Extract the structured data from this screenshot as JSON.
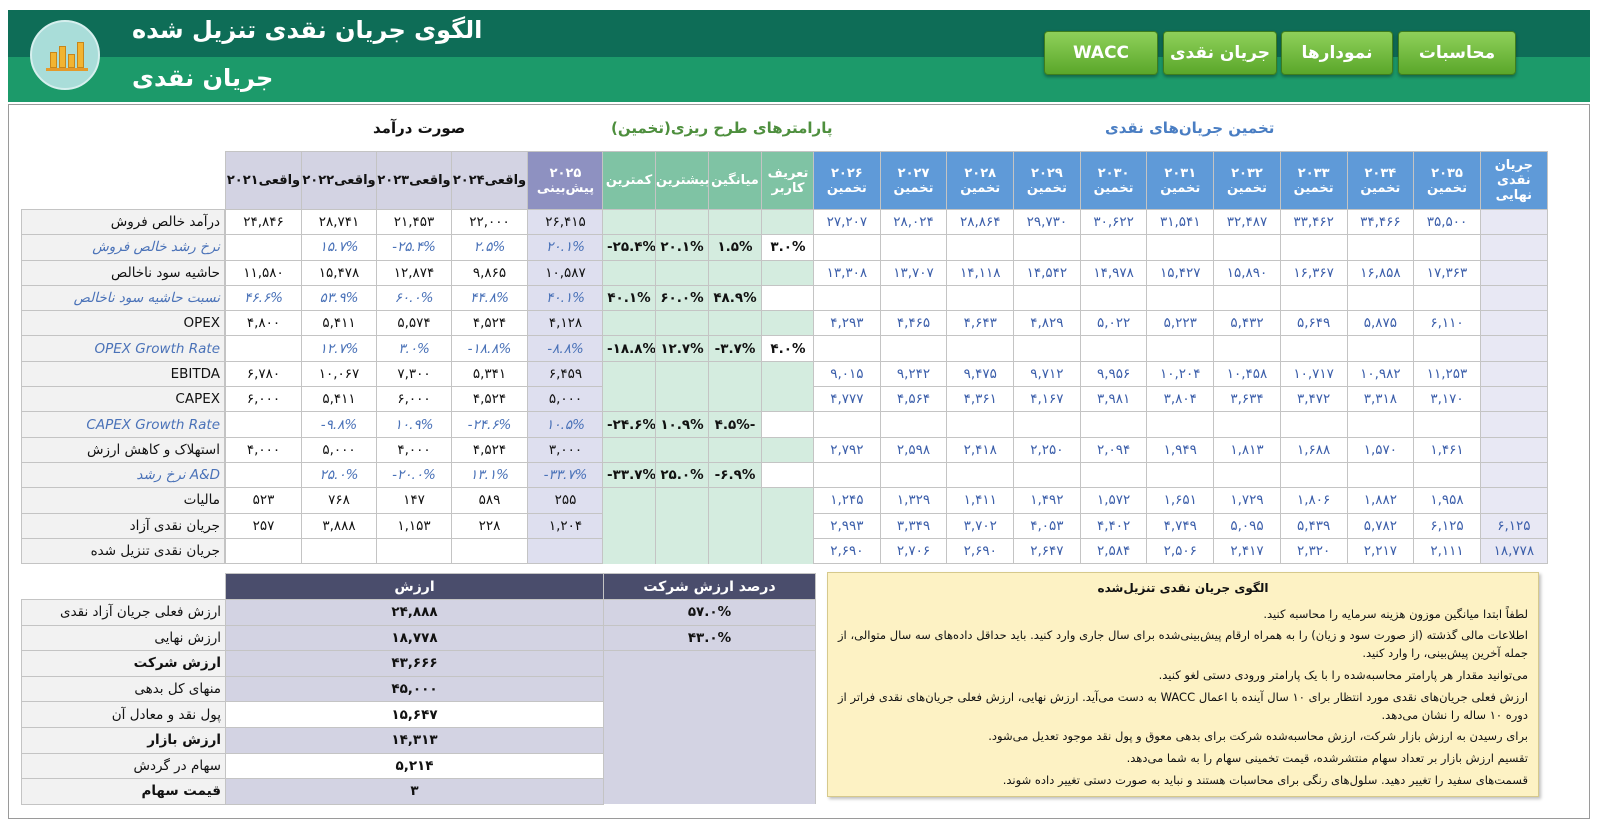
{
  "header": {
    "title": "الگوی جریان نقدی تنزیل شده",
    "subtitle": "جریان نقدی",
    "nav": [
      "محاسبات",
      "نمودارها",
      "جریان نقدی",
      "WACC"
    ]
  },
  "sections": {
    "income": "صورت درآمد",
    "params": "پارامترهای طرح ریزی(تخمین)",
    "forecast": "تخمین جریان‌های نقدی"
  },
  "rows": [
    {
      "label": "درآمد خالص فروش",
      "style": "normal"
    },
    {
      "label": "نرخ رشد خالص فروش",
      "style": "blue"
    },
    {
      "label": "حاشیه سود ناخالص",
      "style": "normal"
    },
    {
      "label": "نسبت حاشیه سود ناخالص",
      "style": "blue"
    },
    {
      "label": "OPEX",
      "style": "normal"
    },
    {
      "label": "OPEX Growth Rate",
      "style": "blue"
    },
    {
      "label": "EBITDA",
      "style": "normal"
    },
    {
      "label": "CAPEX",
      "style": "normal"
    },
    {
      "label": "CAPEX Growth Rate",
      "style": "blue"
    },
    {
      "label": "استهلاک و کاهش ارزش",
      "style": "normal"
    },
    {
      "label": "نرخ رشد A&D",
      "style": "blue"
    },
    {
      "label": "مالیات",
      "style": "normal"
    },
    {
      "label": "جریان نقدی آزاد",
      "style": "normal"
    },
    {
      "label": "جریان نقدی تنزیل شده",
      "style": "normal"
    }
  ],
  "income": {
    "headers": [
      "۲۰۲۱واقعی",
      "۲۰۲۲واقعی",
      "۲۰۲۳واقعی",
      "۲۰۲۴واقعی",
      "۲۰۲۵ پیش‌بینی"
    ],
    "rows": [
      [
        "۲۴,۸۴۶",
        "۲۸,۷۴۱",
        "۲۱,۴۵۳",
        "۲۲,۰۰۰",
        "۲۶,۴۱۵"
      ],
      [
        "",
        "۱۵.۷%",
        "-۲۵.۴%",
        "۲.۵%",
        "۲۰.۱%"
      ],
      [
        "۱۱,۵۸۰",
        "۱۵,۴۷۸",
        "۱۲,۸۷۴",
        "۹,۸۶۵",
        "۱۰,۵۸۷"
      ],
      [
        "۴۶.۶%",
        "۵۳.۹%",
        "۶۰.۰%",
        "۴۴.۸%",
        "۴۰.۱%"
      ],
      [
        "۴,۸۰۰",
        "۵,۴۱۱",
        "۵,۵۷۴",
        "۴,۵۲۴",
        "۴,۱۲۸"
      ],
      [
        "",
        "۱۲.۷%",
        "۳.۰%",
        "-۱۸.۸%",
        "-۸.۸%"
      ],
      [
        "۶,۷۸۰",
        "۱۰,۰۶۷",
        "۷,۳۰۰",
        "۵,۳۴۱",
        "۶,۴۵۹"
      ],
      [
        "۶,۰۰۰",
        "۵,۴۱۱",
        "۶,۰۰۰",
        "۴,۵۲۴",
        "۵,۰۰۰"
      ],
      [
        "",
        "-۹.۸%",
        "۱۰.۹%",
        "-۲۴.۶%",
        "۱۰.۵%"
      ],
      [
        "۴,۰۰۰",
        "۵,۰۰۰",
        "۴,۰۰۰",
        "۴,۵۲۴",
        "۳,۰۰۰"
      ],
      [
        "",
        "۲۵.۰%",
        "-۲۰.۰%",
        "۱۳.۱%",
        "-۳۳.۷%"
      ],
      [
        "۵۲۳",
        "۷۶۸",
        "۱۴۷",
        "۵۸۹",
        "۲۵۵"
      ],
      [
        "۲۵۷",
        "۳,۸۸۸",
        "۱,۱۵۳",
        "۲۲۸",
        "۱,۲۰۴"
      ],
      [
        "",
        "",
        "",
        "",
        ""
      ]
    ]
  },
  "params": {
    "headers": [
      "کمترین",
      "بیشترین",
      "میانگین",
      "تعریف کاربر"
    ],
    "rows": [
      [
        "",
        "",
        "",
        ""
      ],
      [
        "-۲۵.۴%",
        "۲۰.۱%",
        "۱.۵%",
        "۳.۰%"
      ],
      [
        "",
        "",
        "",
        ""
      ],
      [
        "۴۰.۱%",
        "۶۰.۰%",
        "۴۸.۹%",
        ""
      ],
      [
        "",
        "",
        "",
        ""
      ],
      [
        "-۱۸.۸%",
        "۱۲.۷%",
        "-۳.۷%",
        "۴.۰%"
      ],
      [
        "",
        "",
        "",
        ""
      ],
      [
        "",
        "",
        "",
        ""
      ],
      [
        "-۲۴.۶%",
        "۱۰.۹%",
        "۴.۵%-",
        ""
      ],
      [
        "",
        "",
        "",
        ""
      ],
      [
        "-۳۳.۷%",
        "۲۵.۰%",
        "-۶.۹%",
        ""
      ],
      [
        "",
        "",
        "",
        ""
      ],
      [
        "",
        "",
        "",
        ""
      ],
      [
        "",
        "",
        "",
        ""
      ]
    ],
    "user_rows": [
      1,
      3,
      5,
      8,
      10
    ]
  },
  "forecast": {
    "headers": [
      "۲۰۲۶ تخمین",
      "۲۰۲۷ تخمین",
      "۲۰۲۸ تخمین",
      "۲۰۲۹ تخمین",
      "۲۰۳۰ تخمین",
      "۲۰۳۱ تخمین",
      "۲۰۳۲ تخمین",
      "۲۰۳۳ تخمین",
      "۲۰۳۴ تخمین",
      "۲۰۳۵ تخمین",
      "جریان نقدی نهایی"
    ],
    "rows": [
      [
        "۲۷,۲۰۷",
        "۲۸,۰۲۴",
        "۲۸,۸۶۴",
        "۲۹,۷۳۰",
        "۳۰,۶۲۲",
        "۳۱,۵۴۱",
        "۳۲,۴۸۷",
        "۳۳,۴۶۲",
        "۳۴,۴۶۶",
        "۳۵,۵۰۰",
        ""
      ],
      [
        "",
        "",
        "",
        "",
        "",
        "",
        "",
        "",
        "",
        "",
        ""
      ],
      [
        "۱۳,۳۰۸",
        "۱۳,۷۰۷",
        "۱۴,۱۱۸",
        "۱۴,۵۴۲",
        "۱۴,۹۷۸",
        "۱۵,۴۲۷",
        "۱۵,۸۹۰",
        "۱۶,۳۶۷",
        "۱۶,۸۵۸",
        "۱۷,۳۶۳",
        ""
      ],
      [
        "",
        "",
        "",
        "",
        "",
        "",
        "",
        "",
        "",
        "",
        ""
      ],
      [
        "۴,۲۹۳",
        "۴,۴۶۵",
        "۴,۶۴۳",
        "۴,۸۲۹",
        "۵,۰۲۲",
        "۵,۲۲۳",
        "۵,۴۳۲",
        "۵,۶۴۹",
        "۵,۸۷۵",
        "۶,۱۱۰",
        ""
      ],
      [
        "",
        "",
        "",
        "",
        "",
        "",
        "",
        "",
        "",
        "",
        ""
      ],
      [
        "۹,۰۱۵",
        "۹,۲۴۲",
        "۹,۴۷۵",
        "۹,۷۱۲",
        "۹,۹۵۶",
        "۱۰,۲۰۴",
        "۱۰,۴۵۸",
        "۱۰,۷۱۷",
        "۱۰,۹۸۲",
        "۱۱,۲۵۳",
        ""
      ],
      [
        "۴,۷۷۷",
        "۴,۵۶۴",
        "۴,۳۶۱",
        "۴,۱۶۷",
        "۳,۹۸۱",
        "۳,۸۰۴",
        "۳,۶۳۴",
        "۳,۴۷۲",
        "۳,۳۱۸",
        "۳,۱۷۰",
        ""
      ],
      [
        "",
        "",
        "",
        "",
        "",
        "",
        "",
        "",
        "",
        "",
        ""
      ],
      [
        "۲,۷۹۲",
        "۲,۵۹۸",
        "۲,۴۱۸",
        "۲,۲۵۰",
        "۲,۰۹۴",
        "۱,۹۴۹",
        "۱,۸۱۳",
        "۱,۶۸۸",
        "۱,۵۷۰",
        "۱,۴۶۱",
        ""
      ],
      [
        "",
        "",
        "",
        "",
        "",
        "",
        "",
        "",
        "",
        "",
        ""
      ],
      [
        "۱,۲۴۵",
        "۱,۳۲۹",
        "۱,۴۱۱",
        "۱,۴۹۲",
        "۱,۵۷۲",
        "۱,۶۵۱",
        "۱,۷۲۹",
        "۱,۸۰۶",
        "۱,۸۸۲",
        "۱,۹۵۸",
        ""
      ],
      [
        "۲,۹۹۳",
        "۳,۳۴۹",
        "۳,۷۰۲",
        "۴,۰۵۳",
        "۴,۴۰۲",
        "۴,۷۴۹",
        "۵,۰۹۵",
        "۵,۴۳۹",
        "۵,۷۸۲",
        "۶,۱۲۵",
        "۶,۱۲۵"
      ],
      [
        "۲,۶۹۰",
        "۲,۷۰۶",
        "۲,۶۹۰",
        "۲,۶۴۷",
        "۲,۵۸۴",
        "۲,۵۰۶",
        "۲,۴۱۷",
        "۲,۳۲۰",
        "۲,۲۱۷",
        "۲,۱۱۱",
        "۱۸,۷۷۸"
      ]
    ]
  },
  "valuation": {
    "value_header": "ارزش",
    "pct_header": "درصد ارزش شرکت",
    "rows": [
      {
        "label": "ارزش فعلی جریان آزاد نقدی",
        "value": "۲۴,۸۸۸",
        "pct": "۵۷.۰%",
        "bold": false,
        "white": false
      },
      {
        "label": "ارزش نهایی",
        "value": "۱۸,۷۷۸",
        "pct": "۴۳.۰%",
        "bold": false,
        "white": false
      },
      {
        "label": "ارزش شرکت",
        "value": "۴۳,۶۶۶",
        "pct": "",
        "bold": true,
        "white": false
      },
      {
        "label": "منهای کل بدهی",
        "value": "۴۵,۰۰۰",
        "pct": "",
        "bold": false,
        "white": false
      },
      {
        "label": "پول نقد و معادل آن",
        "value": "۱۵,۶۴۷",
        "pct": "",
        "bold": false,
        "white": true
      },
      {
        "label": "ارزش بازار",
        "value": "۱۴,۳۱۳",
        "pct": "",
        "bold": true,
        "white": false
      },
      {
        "label": "سهام در گردش",
        "value": "۵,۲۱۴",
        "pct": "",
        "bold": false,
        "white": true
      },
      {
        "label": "قیمت سهام",
        "value": "۳",
        "pct": "",
        "bold": true,
        "white": false
      }
    ]
  },
  "info": {
    "title": "الگوی جریان نقدی تنزیل‌شده",
    "lines": [
      "لطفاً ابتدا میانگین موزون هزینه سرمایه را محاسبه کنید.",
      "اطلاعات مالی گذشته (از صورت سود و زیان) را به همراه ارقام پیش‌بینی‌شده برای سال جاری وارد کنید. باید حداقل داده‌های سه سال متوالی، از جمله آخرین پیش‌بینی، را وارد کنید.",
      "می‌توانید مقدار هر پارامتر محاسبه‌شده را با یک پارامتر ورودی دستی لغو کنید.",
      "ارزش فعلی جریان‌های نقدی مورد انتظار برای ۱۰ سال آینده با اعمال WACC به دست می‌آید. ارزش نهایی، ارزش فعلی جریان‌های نقدی فراتر از دوره ۱۰ ساله را نشان می‌دهد.",
      "برای رسیدن به ارزش بازار شرکت، ارزش محاسبه‌شده شرکت برای بدهی معوق و پول نقد موجود تعدیل می‌شود.",
      "تقسیم ارزش بازار بر تعداد سهام منتشرشده، قیمت تخمینی سهام را به شما می‌دهد.",
      "قسمت‌های سفید را تغییر دهید. سلول‌های رنگی برای محاسبات هستند و نباید به صورت دستی تغییر داده شوند."
    ]
  }
}
